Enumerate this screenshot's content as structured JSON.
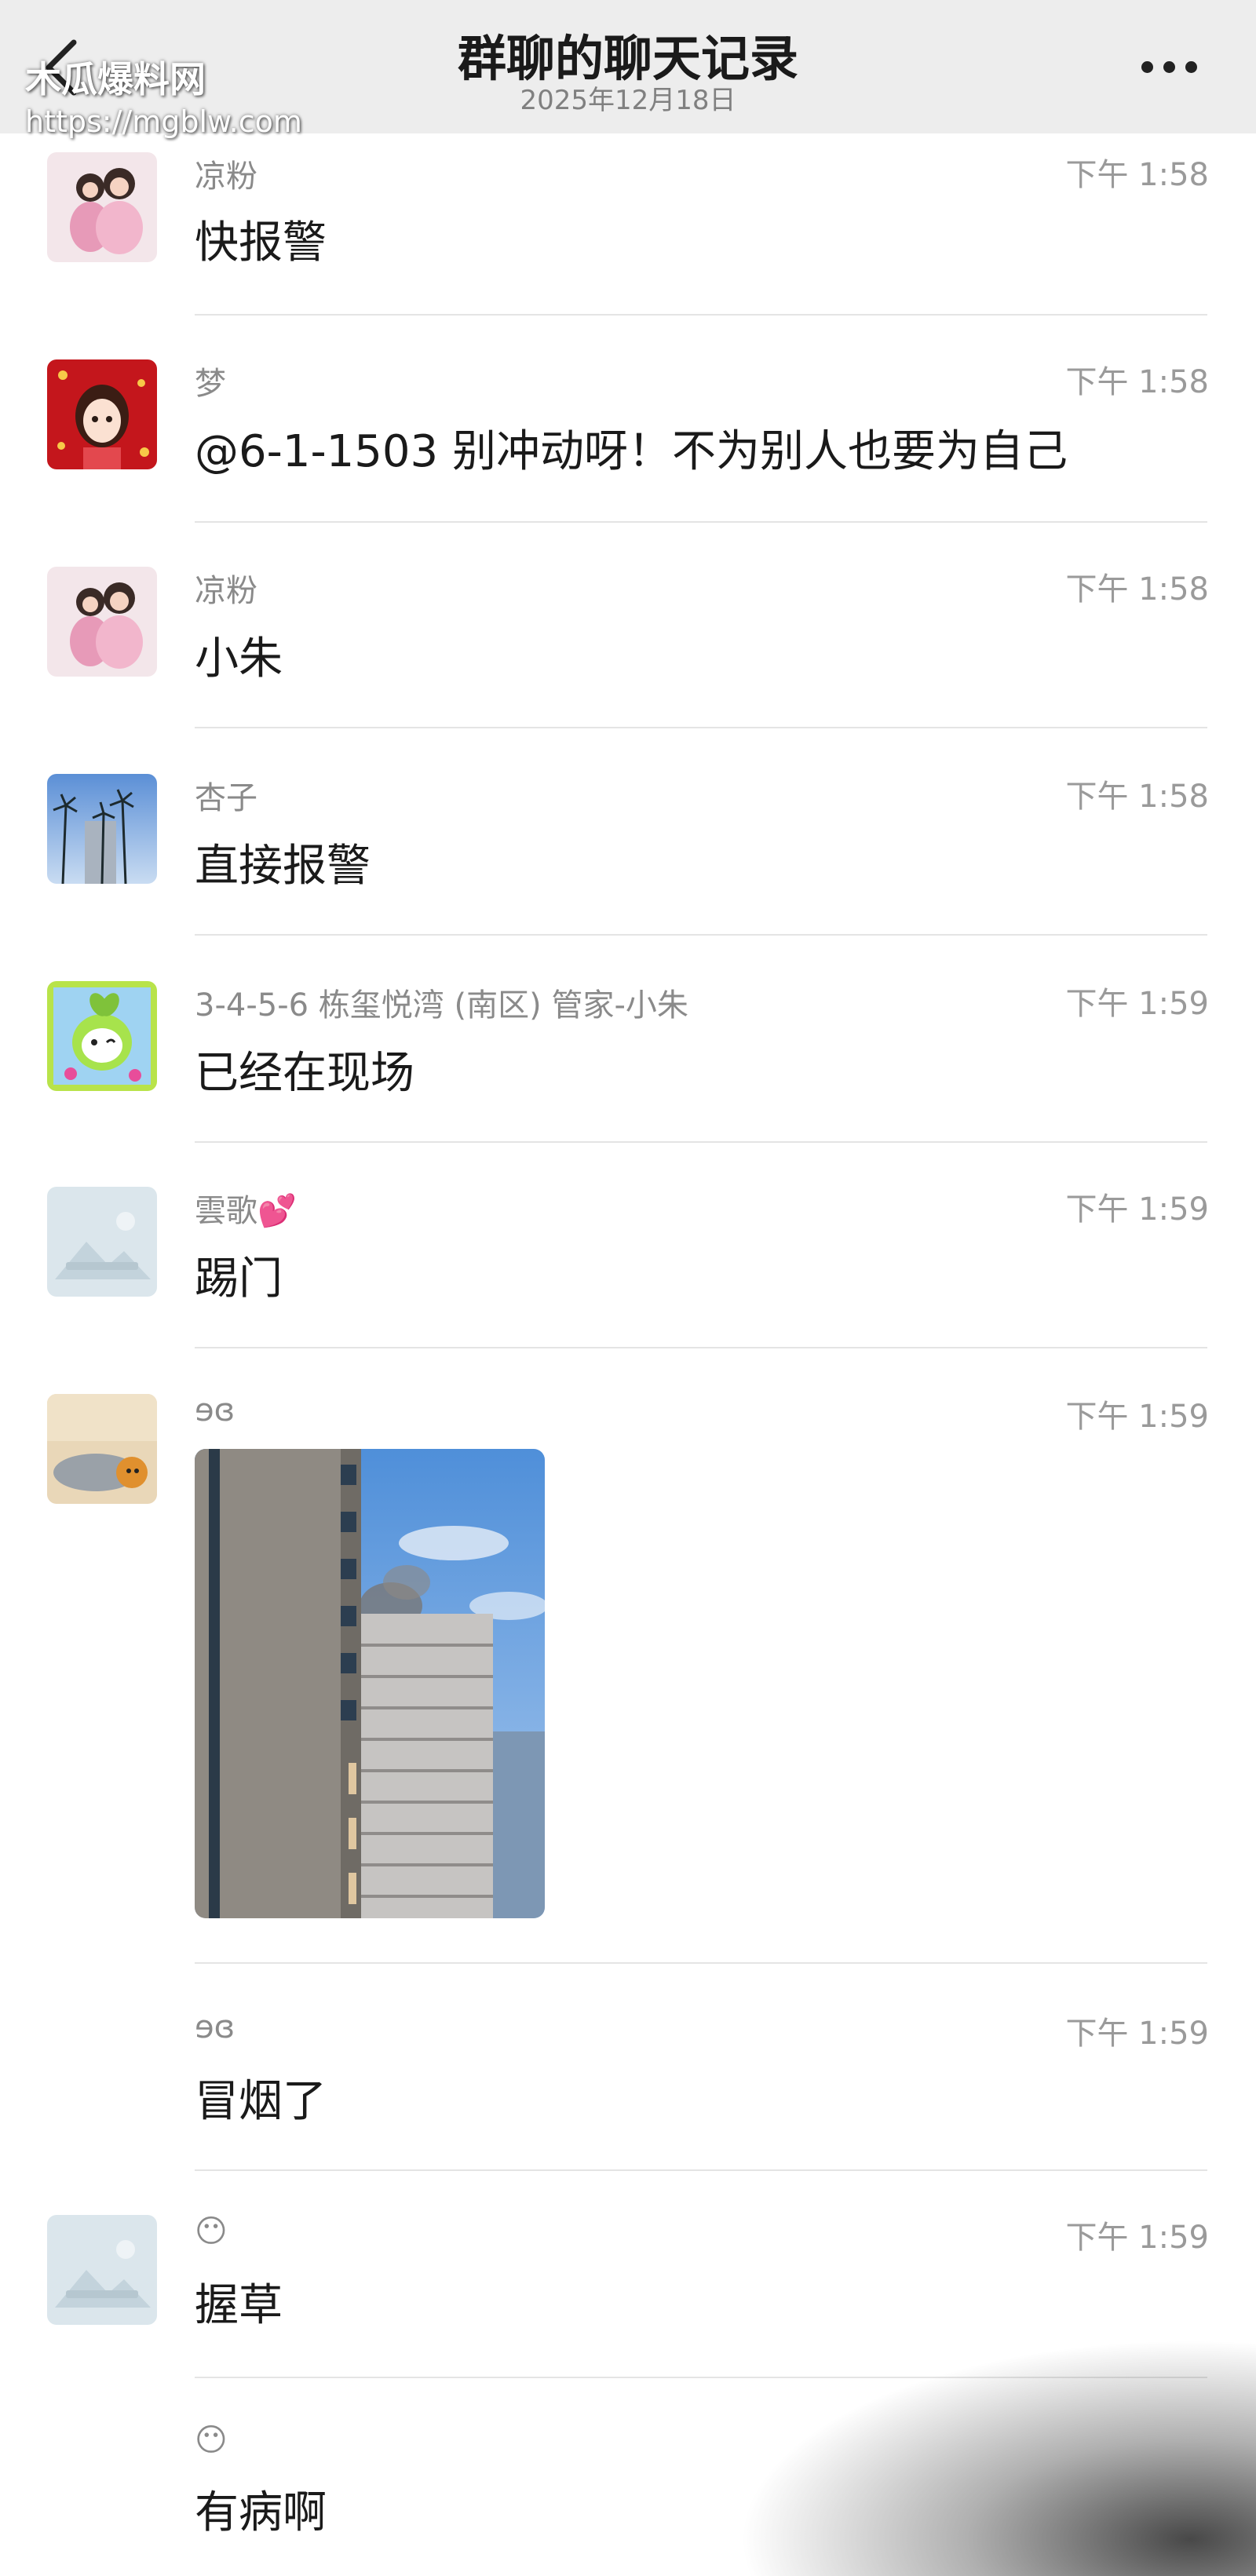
{
  "header": {
    "title": "群聊的聊天记录",
    "date": "2025年12月18日"
  },
  "watermark": {
    "name": "木瓜爆料网",
    "url": "https://mgblw.com"
  },
  "messages": [
    {
      "sender": "凉粉",
      "time": "下午 1:58",
      "text": "快报警"
    },
    {
      "sender": "梦",
      "time": "下午 1:58",
      "text": "@6-1-1503 别冲动呀！不为别人也要为自己"
    },
    {
      "sender": "凉粉",
      "time": "下午 1:58",
      "text": "小朱"
    },
    {
      "sender": "杏子",
      "time": "下午 1:58",
      "text": "直接报警"
    },
    {
      "sender": "3-4-5-6 栋玺悦湾 (南区) 管家-小朱",
      "time": "下午 1:59",
      "text": "已经在现场"
    },
    {
      "sender": "雲歌💕",
      "time": "下午 1:59",
      "text": "踢门"
    },
    {
      "sender": "ɘɞ",
      "time": "下午 1:59",
      "text": ""
    },
    {
      "sender": "ɘɞ",
      "time": "下午 1:59",
      "text": "冒烟了"
    },
    {
      "sender": "😶",
      "time": "下午 1:59",
      "text": "握草"
    },
    {
      "sender": "😶",
      "time": "",
      "text": "有病啊"
    }
  ],
  "colors": {
    "header_bg": "#ededed",
    "divider": "#e4e4e4",
    "secondary_text": "#8a8a8a"
  }
}
